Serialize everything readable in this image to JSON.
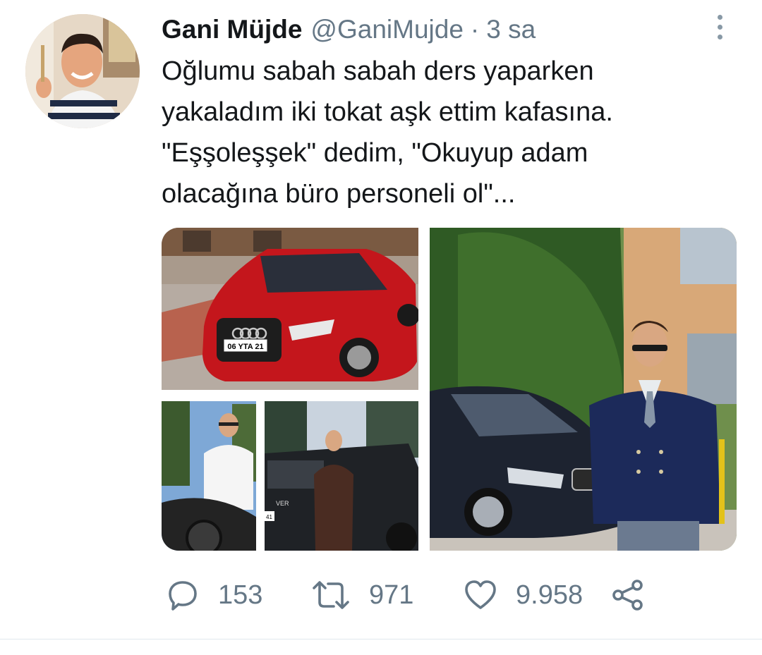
{
  "tweet": {
    "author": {
      "display_name": "Gani Müjde",
      "handle": "@GaniMujde",
      "avatar_icon": "profile-photo"
    },
    "separator": "·",
    "time": "3 sa",
    "text_lines": [
      "Oğlumu sabah sabah ders yaparken",
      "yakaladım iki tokat aşk ettim kafasına.",
      "\"Eşşoleşşek\" dedim, \"Okuyup adam",
      "olacağına büro personeli ol\"..."
    ],
    "media": {
      "count": 4,
      "plate_text": "06 YTA 21",
      "badge_text": "VER",
      "badge_text_2": "41",
      "audi_ring_color": "#c8c8c8",
      "red_car_color": "#c4161c",
      "suit_color": "#1c2a5a"
    },
    "actions": {
      "reply": {
        "icon": "reply-icon",
        "count": "153"
      },
      "retweet": {
        "icon": "retweet-icon",
        "count": "971"
      },
      "like": {
        "icon": "heart-icon",
        "count": "9.958"
      },
      "share": {
        "icon": "share-icon"
      }
    },
    "more_icon": "more-vertical-icon"
  },
  "colors": {
    "text_primary": "#14171a",
    "text_secondary": "#657786",
    "icon_gray": "#8899a6",
    "divider": "#e1e8ed"
  }
}
